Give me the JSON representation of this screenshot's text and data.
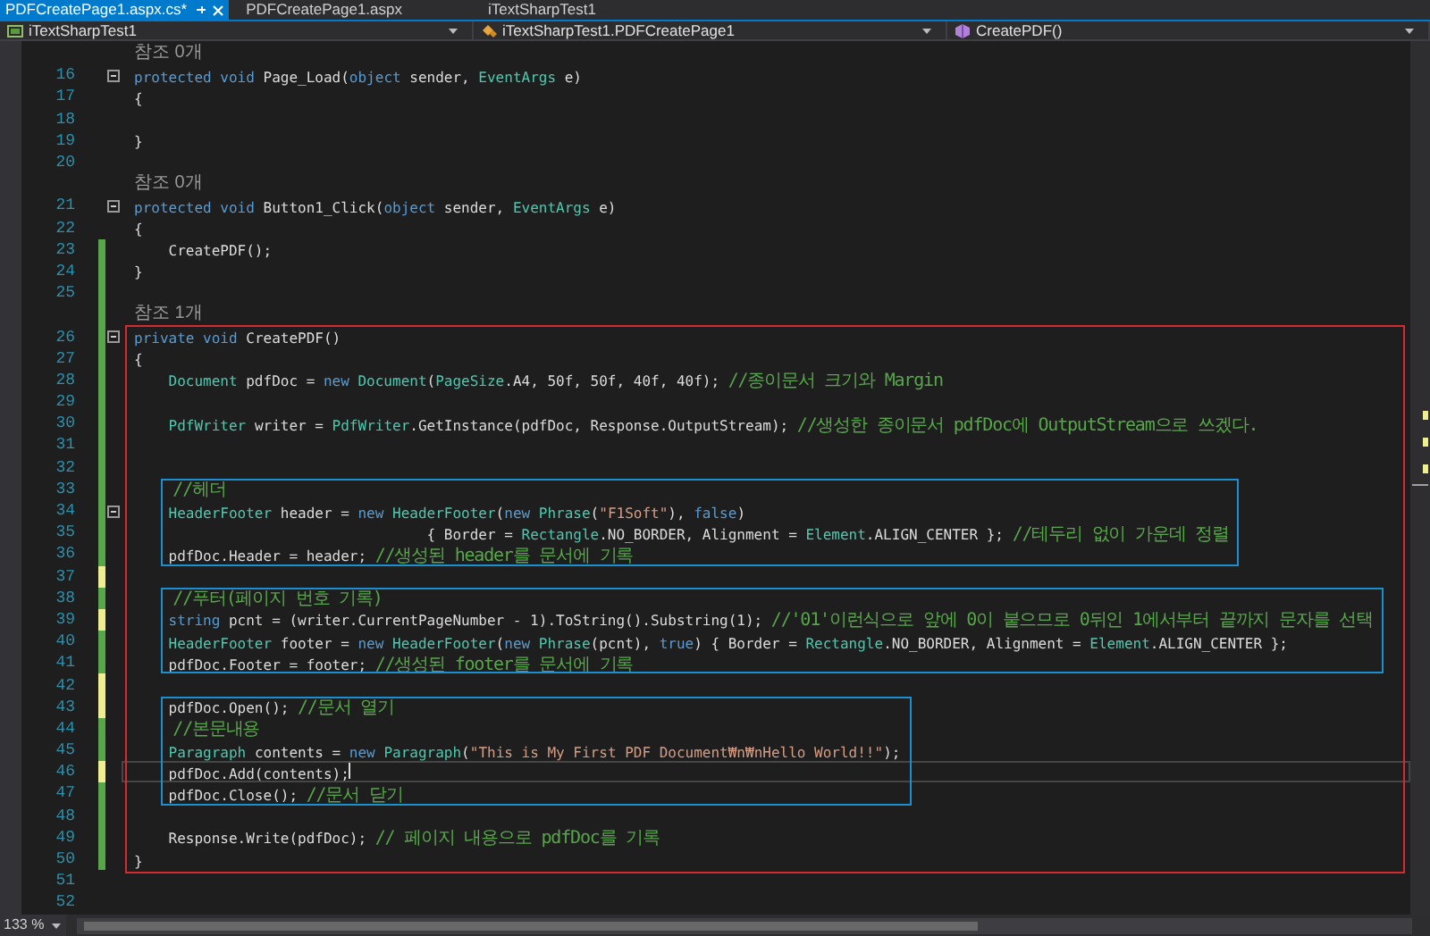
{
  "tabs": [
    {
      "label": "PDFCreatePage1.aspx.cs*",
      "selected": true
    },
    {
      "label": "PDFCreatePage1.aspx",
      "selected": false
    },
    {
      "label": "iTextSharpTest1",
      "selected": false
    }
  ],
  "navigation": [
    {
      "kind": "project",
      "label": "iTextSharpTest1"
    },
    {
      "kind": "class",
      "label": "iTextSharpTest1.PDFCreatePage1"
    },
    {
      "kind": "method",
      "label": "CreatePDF()"
    }
  ],
  "lines": [
    {
      "kind": "codelens",
      "text": "참조 0개"
    },
    {
      "kind": "code",
      "number": "16",
      "foldable": true,
      "tokens": [
        {
          "kind": "keyword",
          "text": "protected void "
        },
        {
          "kind": "plain",
          "text": "Page_Load("
        },
        {
          "kind": "keyword",
          "text": "object "
        },
        {
          "kind": "plain",
          "text": "sender, "
        },
        {
          "kind": "type",
          "text": "EventArgs"
        },
        {
          "kind": "plain",
          "text": " e)"
        }
      ]
    },
    {
      "kind": "code",
      "number": "17",
      "tokens": [
        {
          "kind": "plain",
          "text": "{"
        }
      ]
    },
    {
      "kind": "code",
      "number": "18"
    },
    {
      "kind": "code",
      "number": "19",
      "tokens": [
        {
          "kind": "plain",
          "text": "}"
        }
      ]
    },
    {
      "kind": "code",
      "number": "20"
    },
    {
      "kind": "codelens",
      "text": "참조 0개"
    },
    {
      "kind": "code",
      "number": "21",
      "foldable": true,
      "tokens": [
        {
          "kind": "keyword",
          "text": "protected void "
        },
        {
          "kind": "plain",
          "text": "Button1_Click("
        },
        {
          "kind": "keyword",
          "text": "object "
        },
        {
          "kind": "plain",
          "text": "sender, "
        },
        {
          "kind": "type",
          "text": "EventArgs"
        },
        {
          "kind": "plain",
          "text": " e)"
        }
      ]
    },
    {
      "kind": "code",
      "number": "22",
      "tokens": [
        {
          "kind": "plain",
          "text": "{"
        }
      ]
    },
    {
      "kind": "code",
      "number": "23",
      "modified": true,
      "saved": true,
      "tokens": [
        {
          "kind": "plain",
          "text": "    CreatePDF();"
        }
      ]
    },
    {
      "kind": "code",
      "number": "24",
      "modified": true,
      "saved": true,
      "tokens": [
        {
          "kind": "plain",
          "text": "}"
        }
      ]
    },
    {
      "kind": "code",
      "number": "25",
      "modified": true,
      "saved": true
    },
    {
      "kind": "codelens",
      "text": "참조 1개",
      "modified": true,
      "saved": true
    },
    {
      "kind": "frame",
      "color": "#d42a32",
      "lines": [
        {
          "kind": "code",
          "number": "26",
          "modified": true,
          "saved": true,
          "foldable": true,
          "tokens": [
            {
              "kind": "keyword",
              "text": "private void "
            },
            {
              "kind": "plain",
              "text": "CreatePDF()"
            }
          ]
        },
        {
          "kind": "code",
          "number": "27",
          "modified": true,
          "saved": true,
          "tokens": [
            {
              "kind": "plain",
              "text": "{"
            }
          ]
        },
        {
          "kind": "code",
          "number": "28",
          "modified": true,
          "saved": true,
          "tokens": [
            {
              "kind": "type",
              "text": "    Document"
            },
            {
              "kind": "plain",
              "text": " pdfDoc = "
            },
            {
              "kind": "keyword",
              "text": "new "
            },
            {
              "kind": "type",
              "text": "Document"
            },
            {
              "kind": "plain",
              "text": "("
            },
            {
              "kind": "type",
              "text": "PageSize"
            },
            {
              "kind": "plain",
              "text": ".A4, 50f, 50f, 40f, 40f); "
            },
            {
              "kind": "comment",
              "text": "//종이문서 크기와 Margin"
            }
          ]
        },
        {
          "kind": "code",
          "number": "29",
          "modified": true,
          "saved": true
        },
        {
          "kind": "code",
          "number": "30",
          "modified": true,
          "saved": true,
          "tokens": [
            {
              "kind": "type",
              "text": "    PdfWriter"
            },
            {
              "kind": "plain",
              "text": " writer = "
            },
            {
              "kind": "type",
              "text": "PdfWriter"
            },
            {
              "kind": "plain",
              "text": ".GetInstance(pdfDoc, Response.OutputStream); "
            },
            {
              "kind": "comment",
              "text": "//생성한 종이문서 pdfDoc에 OutputStream으로 쓰겠다."
            }
          ]
        },
        {
          "kind": "code",
          "number": "31",
          "modified": true,
          "saved": true
        },
        {
          "kind": "code",
          "number": "32",
          "modified": true,
          "saved": true
        },
        {
          "kind": "frame",
          "color": "#1c8fd0",
          "lines": [
            {
              "kind": "code",
              "number": "33",
              "modified": true,
              "saved": true,
              "tokens": [
                {
                  "kind": "comment",
                  "text": "    //헤더"
                }
              ]
            },
            {
              "kind": "code",
              "number": "34",
              "modified": true,
              "saved": true,
              "foldable": true,
              "tokens": [
                {
                  "kind": "type",
                  "text": "    HeaderFooter"
                },
                {
                  "kind": "plain",
                  "text": " header = "
                },
                {
                  "kind": "keyword",
                  "text": "new "
                },
                {
                  "kind": "type",
                  "text": "HeaderFooter"
                },
                {
                  "kind": "plain",
                  "text": "("
                },
                {
                  "kind": "keyword",
                  "text": "new "
                },
                {
                  "kind": "type",
                  "text": "Phrase"
                },
                {
                  "kind": "plain",
                  "text": "("
                },
                {
                  "kind": "string",
                  "text": "\"F1Soft\""
                },
                {
                  "kind": "plain",
                  "text": "), "
                },
                {
                  "kind": "keyword",
                  "text": "false"
                },
                {
                  "kind": "plain",
                  "text": ")"
                }
              ]
            },
            {
              "kind": "code",
              "number": "35",
              "modified": true,
              "saved": true,
              "tokens": [
                {
                  "kind": "plain",
                  "text": "                                  { Border = "
                },
                {
                  "kind": "type",
                  "text": "Rectangle"
                },
                {
                  "kind": "plain",
                  "text": ".NO_BORDER, Alignment = "
                },
                {
                  "kind": "type",
                  "text": "Element"
                },
                {
                  "kind": "plain",
                  "text": ".ALIGN_CENTER }; "
                },
                {
                  "kind": "comment",
                  "text": "//테두리 없이 가운데 정렬"
                }
              ]
            },
            {
              "kind": "code",
              "number": "36",
              "modified": true,
              "saved": true,
              "tokens": [
                {
                  "kind": "plain",
                  "text": "    pdfDoc.Header = header; "
                },
                {
                  "kind": "comment",
                  "text": "//생성된 header를 문서에 기록"
                }
              ]
            }
          ]
        },
        {
          "kind": "code",
          "number": "37",
          "modified": true,
          "saved": false
        },
        {
          "kind": "frame",
          "color": "#1c8fd0",
          "lines": [
            {
              "kind": "code",
              "number": "38",
              "modified": true,
              "saved": true,
              "tokens": [
                {
                  "kind": "comment",
                  "text": "    //푸터(페이지 번호 기록)"
                }
              ]
            },
            {
              "kind": "code",
              "number": "39",
              "modified": true,
              "saved": false,
              "tokens": [
                {
                  "kind": "keyword",
                  "text": "    string "
                },
                {
                  "kind": "plain",
                  "text": "pcnt = (writer.CurrentPageNumber - 1).ToString().Substring(1); "
                },
                {
                  "kind": "comment",
                  "text": "//'01'이런식으로 앞에 0이 붙으므로 0뒤인 1에서부터 끝까지 문자를 선택"
                }
              ]
            },
            {
              "kind": "code",
              "number": "40",
              "modified": true,
              "saved": true,
              "tokens": [
                {
                  "kind": "type",
                  "text": "    HeaderFooter"
                },
                {
                  "kind": "plain",
                  "text": " footer = "
                },
                {
                  "kind": "keyword",
                  "text": "new "
                },
                {
                  "kind": "type",
                  "text": "HeaderFooter"
                },
                {
                  "kind": "plain",
                  "text": "("
                },
                {
                  "kind": "keyword",
                  "text": "new "
                },
                {
                  "kind": "type",
                  "text": "Phrase"
                },
                {
                  "kind": "plain",
                  "text": "(pcnt), "
                },
                {
                  "kind": "keyword",
                  "text": "true"
                },
                {
                  "kind": "plain",
                  "text": ") { Border = "
                },
                {
                  "kind": "type",
                  "text": "Rectangle"
                },
                {
                  "kind": "plain",
                  "text": ".NO_BORDER, Alignment = "
                },
                {
                  "kind": "type",
                  "text": "Element"
                },
                {
                  "kind": "plain",
                  "text": ".ALIGN_CENTER };"
                }
              ]
            },
            {
              "kind": "code",
              "number": "41",
              "modified": true,
              "saved": true,
              "tokens": [
                {
                  "kind": "plain",
                  "text": "    pdfDoc.Footer = footer; "
                },
                {
                  "kind": "comment",
                  "text": "//생성된 footer를 문서에 기록"
                }
              ]
            }
          ]
        },
        {
          "kind": "code",
          "number": "42",
          "modified": true,
          "saved": false
        },
        {
          "kind": "frame",
          "color": "#1c8fd0",
          "lines": [
            {
              "kind": "code",
              "number": "43",
              "modified": true,
              "saved": false,
              "tokens": [
                {
                  "kind": "plain",
                  "text": "    pdfDoc.Open(); "
                },
                {
                  "kind": "comment",
                  "text": "//문서 열기"
                }
              ]
            },
            {
              "kind": "code",
              "number": "44",
              "modified": true,
              "saved": true,
              "tokens": [
                {
                  "kind": "comment",
                  "text": "    //본문내용"
                }
              ]
            },
            {
              "kind": "code",
              "number": "45",
              "modified": true,
              "saved": true,
              "tokens": [
                {
                  "kind": "type",
                  "text": "    Paragraph"
                },
                {
                  "kind": "plain",
                  "text": " contents = "
                },
                {
                  "kind": "keyword",
                  "text": "new "
                },
                {
                  "kind": "type",
                  "text": "Paragraph"
                },
                {
                  "kind": "plain",
                  "text": "("
                },
                {
                  "kind": "string",
                  "text": "\"This is My First PDF Document₩n₩nHello World!!\""
                },
                {
                  "kind": "plain",
                  "text": ");"
                }
              ]
            },
            {
              "kind": "code",
              "number": "46",
              "modified": true,
              "saved": false,
              "current": true,
              "tokens": [
                {
                  "kind": "plain",
                  "text": "    pdfDoc.Add(contents);"
                }
              ]
            },
            {
              "kind": "code",
              "number": "47",
              "modified": true,
              "saved": true,
              "tokens": [
                {
                  "kind": "plain",
                  "text": "    pdfDoc.Close(); "
                },
                {
                  "kind": "comment",
                  "text": "//문서 닫기"
                }
              ]
            }
          ]
        },
        {
          "kind": "code",
          "number": "48",
          "modified": true,
          "saved": true
        },
        {
          "kind": "code",
          "number": "49",
          "modified": true,
          "saved": true,
          "tokens": [
            {
              "kind": "plain",
              "text": "    Response.Write(pdfDoc); "
            },
            {
              "kind": "comment",
              "text": "// 페이지 내용으로 pdfDoc를 기록"
            }
          ]
        },
        {
          "kind": "code",
          "number": "50",
          "modified": true,
          "saved": true,
          "tokens": [
            {
              "kind": "plain",
              "text": "}"
            }
          ]
        }
      ]
    },
    {
      "kind": "code",
      "number": "51"
    },
    {
      "kind": "code",
      "number": "52"
    }
  ],
  "status_bar": {
    "zoom": "133 %"
  }
}
